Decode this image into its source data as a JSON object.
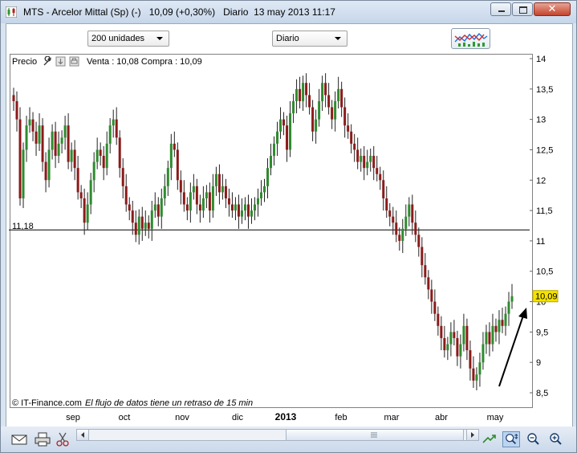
{
  "window": {
    "title_symbol": "MTS - Arcelor Mittal (Sp) (-)",
    "title_quote": "10,09 (+0,30%)",
    "title_period": "Diario",
    "title_datetime": "13 may 2013 11:17",
    "close_glyph": "✕"
  },
  "toolbar": {
    "quantity_value": "200 unidades",
    "period_value": "Diario",
    "chart_type_icon": "indicator-chart-icon"
  },
  "plot": {
    "series_label": "Precio",
    "quote_text": "Venta : 10,08 Compra : 10,09",
    "footer_source": "© IT-Finance.com",
    "footer_delay": "El flujo de datos tiene un retraso de 15 min",
    "header_icons": [
      "wrench-icon",
      "export-icon",
      "print-icon"
    ]
  },
  "statusbar": {
    "icons": [
      "mail-icon",
      "print-icon",
      "scissors-icon",
      "trade-icon",
      "zoom-fit-icon",
      "zoom-out-icon",
      "zoom-in-icon"
    ]
  },
  "chart_data": {
    "type": "candlestick",
    "y_ticks": [
      "14",
      "13,5",
      "13",
      "12,5",
      "12",
      "11,5",
      "11",
      "10,5",
      "10",
      "9,5",
      "9",
      "8,5"
    ],
    "ylim": [
      8.4,
      14.0
    ],
    "x_labels": [
      {
        "label": "sep",
        "bold": false
      },
      {
        "label": "oct",
        "bold": false
      },
      {
        "label": "nov",
        "bold": false
      },
      {
        "label": "dic",
        "bold": false
      },
      {
        "label": "2013",
        "bold": true
      },
      {
        "label": "feb",
        "bold": false
      },
      {
        "label": "mar",
        "bold": false
      },
      {
        "label": "abr",
        "bold": false
      },
      {
        "label": "may",
        "bold": false
      }
    ],
    "horizontal_line": {
      "value": 11.18,
      "label": "11,18"
    },
    "last_price": {
      "value": 10.09,
      "label": "10,09"
    },
    "colors": {
      "up": "#2e8b2e",
      "down": "#8b1a1a",
      "last_price_bg": "#f5e300",
      "line": "#000000"
    },
    "closes": [
      13.3,
      13.0,
      11.7,
      12.5,
      12.9,
      13.0,
      12.8,
      12.6,
      12.9,
      12.3,
      12.0,
      12.5,
      12.8,
      12.4,
      12.6,
      12.7,
      12.9,
      12.3,
      12.5,
      12.2,
      11.8,
      11.7,
      11.3,
      11.6,
      12.0,
      12.3,
      12.5,
      12.4,
      12.2,
      12.6,
      12.9,
      13.0,
      12.7,
      12.2,
      11.9,
      11.6,
      11.5,
      11.3,
      11.1,
      11.4,
      11.2,
      11.3,
      11.2,
      11.5,
      11.6,
      11.4,
      11.7,
      11.9,
      12.2,
      12.6,
      12.5,
      12.0,
      11.8,
      11.6,
      11.5,
      11.8,
      11.9,
      11.6,
      11.5,
      11.7,
      11.8,
      11.5,
      11.9,
      12.1,
      11.8,
      11.9,
      11.7,
      11.6,
      11.5,
      11.6,
      11.4,
      11.5,
      11.6,
      11.4,
      11.5,
      11.6,
      11.7,
      11.8,
      11.9,
      12.2,
      12.4,
      12.6,
      12.8,
      13.0,
      12.9,
      12.5,
      13.1,
      13.3,
      13.5,
      13.3,
      13.6,
      13.4,
      13.2,
      12.8,
      13.0,
      13.3,
      13.6,
      13.4,
      13.2,
      13.0,
      13.3,
      13.5,
      13.2,
      12.9,
      12.8,
      12.6,
      12.5,
      12.3,
      12.4,
      12.2,
      12.3,
      12.4,
      12.2,
      12.1,
      12.0,
      11.7,
      11.5,
      11.4,
      11.3,
      11.1,
      11.0,
      11.2,
      11.4,
      11.6,
      11.3,
      11.1,
      10.9,
      10.6,
      10.4,
      10.2,
      10.0,
      9.8,
      9.6,
      9.4,
      9.2,
      9.3,
      9.5,
      9.4,
      9.1,
      9.3,
      9.6,
      9.2,
      8.9,
      8.7,
      8.8,
      9.0,
      9.3,
      9.5,
      9.3,
      9.6,
      9.5,
      9.7,
      9.6,
      9.8,
      10.0,
      10.09
    ]
  }
}
